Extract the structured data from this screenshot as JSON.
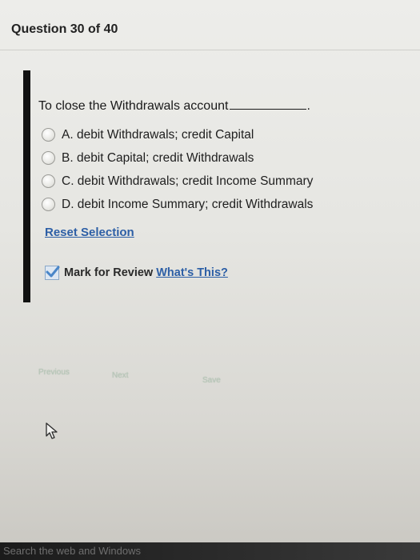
{
  "header": {
    "title": "Question 30 of 40"
  },
  "question": {
    "prompt": "To close the Withdrawals account",
    "trailing": "."
  },
  "options": [
    {
      "label": "A. debit Withdrawals; credit Capital"
    },
    {
      "label": "B. debit Capital; credit Withdrawals"
    },
    {
      "label": "C. debit Withdrawals; credit Income Summary"
    },
    {
      "label": "D. debit Income Summary; credit Withdrawals"
    }
  ],
  "reset_label": "Reset Selection",
  "review": {
    "label": "Mark for Review",
    "checked": true,
    "help_link": "What's This?"
  },
  "nav": {
    "previous_label": "Previous",
    "next_label": "Next",
    "save_label": "Save"
  },
  "taskbar": {
    "search_text": "Search the web and Windows"
  },
  "colors": {
    "link": "#2d5fa6",
    "left_bar": "#111111",
    "check_accent": "#4a86c8"
  }
}
